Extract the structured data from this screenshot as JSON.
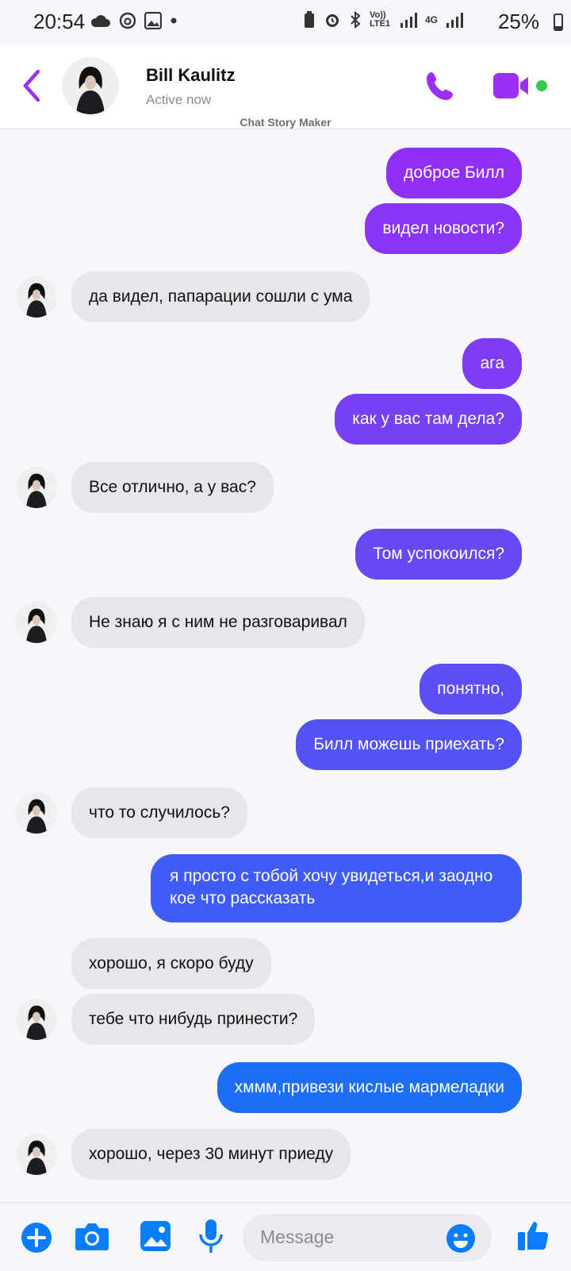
{
  "status_bar": {
    "time": "20:54",
    "network": "4G",
    "volte": "Vo)) LTE1",
    "battery": "25%"
  },
  "header": {
    "name": "Bill Kaulitz",
    "status": "Active now",
    "watermark": "Chat Story Maker"
  },
  "messages": [
    {
      "dir": "out",
      "text": "доброе Билл",
      "color": "#9130f5"
    },
    {
      "dir": "out",
      "text": "видел новости?",
      "color": "#8a34f5"
    },
    {
      "dir": "in",
      "text": "да видел, папарации сошли с ума"
    },
    {
      "dir": "out",
      "text": "ага",
      "color": "#7f3cf5"
    },
    {
      "dir": "out",
      "text": "как у вас там дела?",
      "color": "#7640f5"
    },
    {
      "dir": "in",
      "text": "Все отлично, а у вас?"
    },
    {
      "dir": "out",
      "text": "Том успокоился?",
      "color": "#6a47f5"
    },
    {
      "dir": "in",
      "text": "Не знаю я с ним не разговаривал"
    },
    {
      "dir": "out",
      "text": "понятно,",
      "color": "#5d4ff5"
    },
    {
      "dir": "out",
      "text": "Билл можешь приехать?",
      "color": "#5552f5"
    },
    {
      "dir": "in",
      "text": "что то случилось?"
    },
    {
      "dir": "out",
      "text": "я просто с тобой хочу увидеться,и заодно кое что рассказать",
      "color": "#3f5cf7"
    },
    {
      "dir": "in",
      "text": "хорошо, я скоро буду"
    },
    {
      "dir": "in",
      "text": "тебе что нибудь принести?"
    },
    {
      "dir": "out",
      "text": "хммм,привези кислые мармеладки",
      "color": "#1e6ef5"
    },
    {
      "dir": "in",
      "text": "хорошо, через 30 минут приеду"
    }
  ],
  "input": {
    "placeholder": "Message"
  },
  "icons": {
    "back": "chevron-left-icon",
    "call": "phone-icon",
    "video": "video-camera-icon",
    "add": "plus-icon",
    "camera": "camera-icon",
    "gallery": "image-icon",
    "mic": "microphone-icon",
    "emoji": "emoji-icon",
    "like": "thumbs-up-icon"
  },
  "colors": {
    "accent": "#9b2ff5",
    "input_icons": "#0a7cff",
    "online": "#31cc46"
  }
}
